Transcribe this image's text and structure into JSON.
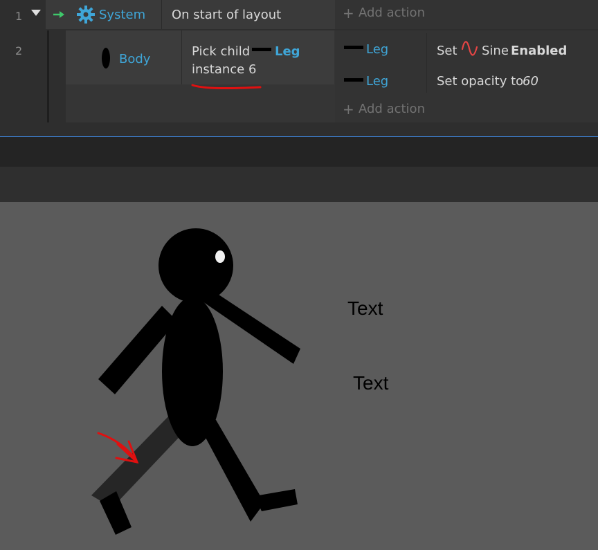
{
  "event_sheet": {
    "event1": {
      "number": "1",
      "object": "System",
      "condition": "On start of layout",
      "add_action": "Add action"
    },
    "event2": {
      "number": "2",
      "object": "Body",
      "condition": {
        "prefix": "Pick child",
        "child": "Leg",
        "line2": "instance 6"
      },
      "actions": [
        {
          "object": "Leg",
          "prefix": "Set",
          "behavior": "Sine",
          "value": "Enabled"
        },
        {
          "object": "Leg",
          "prefix": "Set opacity to",
          "value": "60"
        }
      ],
      "add_action": "Add action"
    }
  },
  "layout": {
    "texts": [
      "Text",
      "Text"
    ],
    "colors": {
      "figure": "#000000",
      "highlighted_leg": "#262626",
      "annotation": "#e01010",
      "background": "#5b5b5b"
    }
  }
}
